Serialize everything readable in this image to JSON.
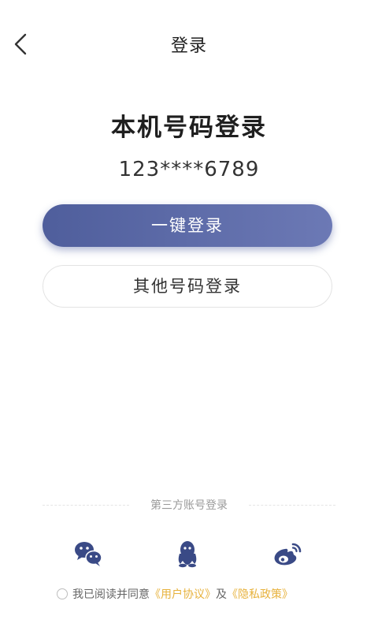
{
  "nav": {
    "title": "登录"
  },
  "main": {
    "title": "本机号码登录",
    "phone_number": "123****6789",
    "primary_button": "一键登录",
    "secondary_button": "其他号码登录"
  },
  "third_party": {
    "divider_label": "第三方账号登录",
    "items": [
      {
        "icon": "wechat-icon"
      },
      {
        "icon": "qq-icon"
      },
      {
        "icon": "weibo-icon"
      }
    ]
  },
  "agreement": {
    "prefix": "我已阅读并同意",
    "user_agreement": "《用户协议》",
    "conjunction": "及",
    "privacy_policy": "《隐私政策》"
  },
  "colors": {
    "primary_start": "#4f5e9c",
    "primary_end": "#6c79b5",
    "icon_color": "#3a4a86",
    "link_color": "#e7b23d"
  }
}
